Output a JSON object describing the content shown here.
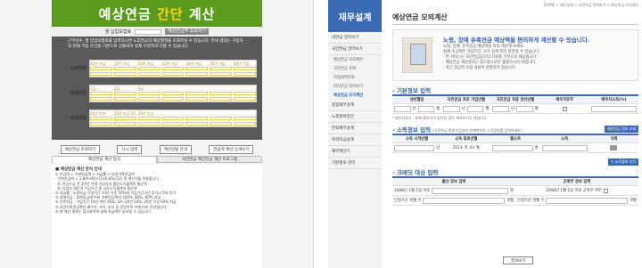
{
  "left": {
    "title_main": "예상연금 ",
    "title_accent": "간단",
    "title_end": " 계산",
    "sub_label": "월 납입보험료",
    "sub_btn": "예상연금액 조회하기",
    "notice": "근무년수, 월 납입보험료를 입력하시면 노후연금의 예상월액을 조회하실 수 있습니다. 안내 결과는 가입자의 현재 가입 조건을 기준으로 산출되며 실제 수령액과 다를 수 있습니다.",
    "groups": [
      {
        "label": "노령연금",
        "cols": [
          "10년 가입",
          "15년 가입",
          "20년 가입",
          "25년 가입",
          "30년 가입",
          "35년 가입",
          "40년 가입"
        ]
      },
      {
        "label": "장애연금",
        "cols": [
          "1급",
          "2급",
          "3급",
          "",
          "",
          "",
          ""
        ]
      },
      {
        "label": "유족연금",
        "cols": [
          "10년 미만",
          "10년 이상 20년 미만",
          "20년 이상",
          "",
          "",
          "",
          ""
        ]
      }
    ],
    "buttons": [
      "예상연금 조회하기",
      "다시 입력",
      "계산방법 안내",
      "연금액 계산 상세보기"
    ],
    "tabs": [
      "예상연금 계산 방식",
      "국민연금 예상연금 계산 프로그램"
    ],
    "body_title": "■ 예상연금 계산 방식 안내",
    "body_lines": [
      "① 연금액 = 기본연금액 × 지급률 + 부양가족연금액",
      "· 기본연금액 = 1.8(A+B)×(1+0.05n/12) 의 계산식을 적용합니다",
      "· A: 연금수급 전 3년간 전체 가입자의 평균소득월액의 평균액",
      "· B: 가입자 개인의 가입기간 중 기준소득월액의 평균액",
      "② 지급률 : 노령연금 가입기간 10년 기준 50%에 가입기간 1년 증가시 5% 증가",
      "③ 장애연금 : 장애등급에 따라 기본연금액의 100%, 80%, 60% 지급",
      "④ 유족연금 : 가입기간 10년 미만 40%, 10~20년 50%, 20년 이상 60% 지급",
      "⑤ 부양가족연금액은 배우자, 자녀, 부모 등 부양가족 수에 따라 가산됩니다",
      "⑥ 본 계산 결과는 참고용이며 실제 지급액은 달라질 수 있습니다"
    ]
  },
  "right": {
    "logo": "재무설계",
    "nav": [
      {
        "label": "내연금 알아보기",
        "sub": false
      },
      {
        "label": "국민연금 알아보기",
        "sub": false
      },
      {
        "label": "예상연금 모의계산",
        "sub": true,
        "on": false
      },
      {
        "label": "국민연금 조회",
        "sub": true,
        "on": false
      },
      {
        "label": "가입내역조회",
        "sub": true,
        "on": false
      },
      {
        "label": "퇴직연금 알아보기",
        "sub": true,
        "on": false
      },
      {
        "label": "예상연금 모의계산",
        "sub": true,
        "on": true
      },
      {
        "label": "종합재무설계",
        "sub": false
      },
      {
        "label": "노후준비진단",
        "sub": false
      },
      {
        "label": "은퇴재무설계",
        "sub": false
      },
      {
        "label": "목적자금설계",
        "sub": false
      },
      {
        "label": "재무계산기",
        "sub": false
      },
      {
        "label": "기본정보 관리",
        "sub": false
      }
    ],
    "breadcrumb": "HOME > 재무설계 > 국민연금 알아보기 > 예상연금 모의계산",
    "page_title": "예상연금 모의계산",
    "lead": "노령, 장애 유족연금 예상액을 편리하게 계산할 수 있습니다.",
    "desc": [
      "노령, 장애, 유족연금 예상액을 미리 계산해 보세요.",
      "실제 수급액은 가입기간, 소득 등에 따라 달라질 수 있습니다.",
      "· 본 서비스는 국민연금공단의 자료를 기반으로 제공됩니다.",
      "· 예상연금 계산결과는 참고용으로만 활용하시기 바랍니다.",
      "· 최근 연금액 조정 내용이 반영되어 있습니다."
    ],
    "sec1": "기본정보 입력",
    "sec1_headers": [
      "생년월일",
      "국민연금 최초 가입년월",
      "국민연금 최종 정년년월",
      "배우자유무",
      "배우자소득(%)"
    ],
    "sec1_units": [
      "년",
      "월",
      "년",
      "월",
      "년",
      "월"
    ],
    "sec1_note": "* 배우자유무 : 현재 배우자가 있으신 경우 체크하시기 바랍니다.",
    "sec2": "소득정보 입력",
    "sec2_note": "(국민연금 최초가입부터 현재까지의 소득정보를 입력하세요.)",
    "sec2_btn": "예상연금 정보 조회",
    "sec2_headers": [
      "소득 시작년월",
      "소득 종료년월",
      "월소득",
      "소득",
      "삭제"
    ],
    "sec2_vals": {
      "start_y": "년",
      "end_y": "2021",
      "end_m": "03",
      "amount_unit": "원"
    },
    "sec2_add": "+ 소득정보 추가",
    "sec3": "크레딧 대상 입력",
    "sec3_headers": [
      "출산 정보 입력",
      "군복무 정보 입력"
    ],
    "sec3_row1": [
      "2008년 1월 1일 이후",
      "명",
      "2008년 1월 1일 이후 군복무 여부"
    ],
    "sec3_row2": [
      "인정가산 개월 수",
      "개월",
      "인정가산 개월 수",
      "개월"
    ],
    "calc_btn": "결과보기"
  }
}
